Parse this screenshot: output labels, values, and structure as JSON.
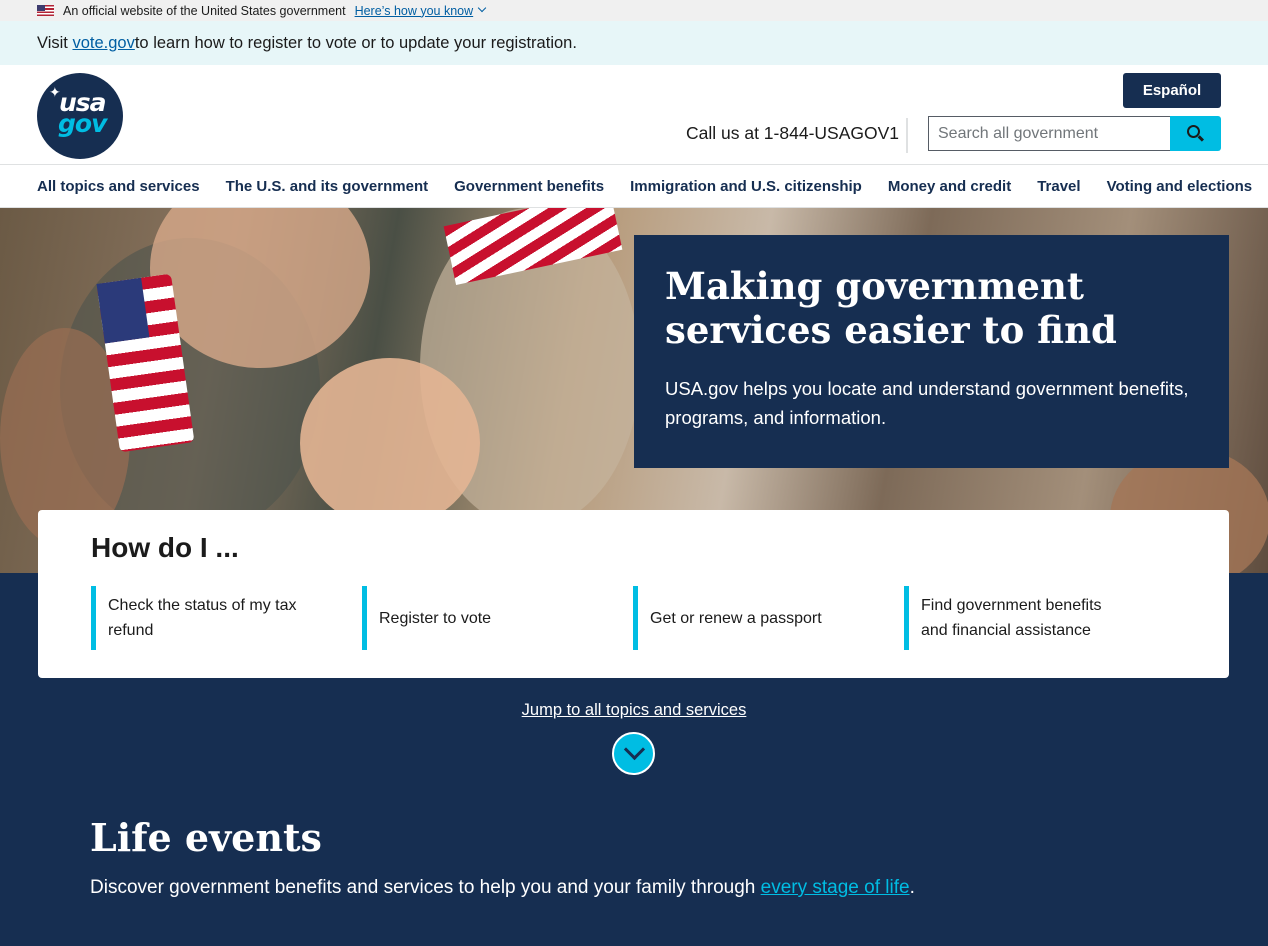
{
  "gov_banner": {
    "text": "An official website of the United States government",
    "link": "Here’s how you know"
  },
  "alert": {
    "prefix": "Visit ",
    "link": "vote.gov",
    "suffix": " to learn how to register to vote or to update your registration."
  },
  "header": {
    "logo_line1": "usa",
    "logo_line2": "gov",
    "language_button": "Español",
    "call_text": "Call us at 1-844-USAGOV1",
    "search_placeholder": "Search all government"
  },
  "nav": {
    "items": [
      "All topics and services",
      "The U.S. and its government",
      "Government benefits",
      "Immigration and U.S. citizenship",
      "Money and credit",
      "Travel",
      "Voting and elections"
    ]
  },
  "hero": {
    "title": "Making government services easier to find",
    "description": "USA.gov helps you locate and understand government benefits, programs, and information."
  },
  "how_do_i": {
    "title": "How do I ...",
    "links": [
      "Check the status of my tax refund",
      "Register to vote",
      "Get or renew a passport",
      "Find government benefits and financial assistance"
    ]
  },
  "jump_link": "Jump to all topics and services",
  "life_events": {
    "title": "Life events",
    "description_prefix": "Discover government benefits and services to help you and your family through ",
    "link": "every stage of life",
    "description_suffix": "."
  },
  "colors": {
    "primary_dark": "#162e51",
    "accent_cyan": "#00bde3",
    "link_blue": "#005ea2",
    "alert_bg": "#e7f6f8"
  },
  "icons": [
    "us-flag-icon",
    "chevron-down-icon",
    "search-icon",
    "jump-down-icon"
  ]
}
